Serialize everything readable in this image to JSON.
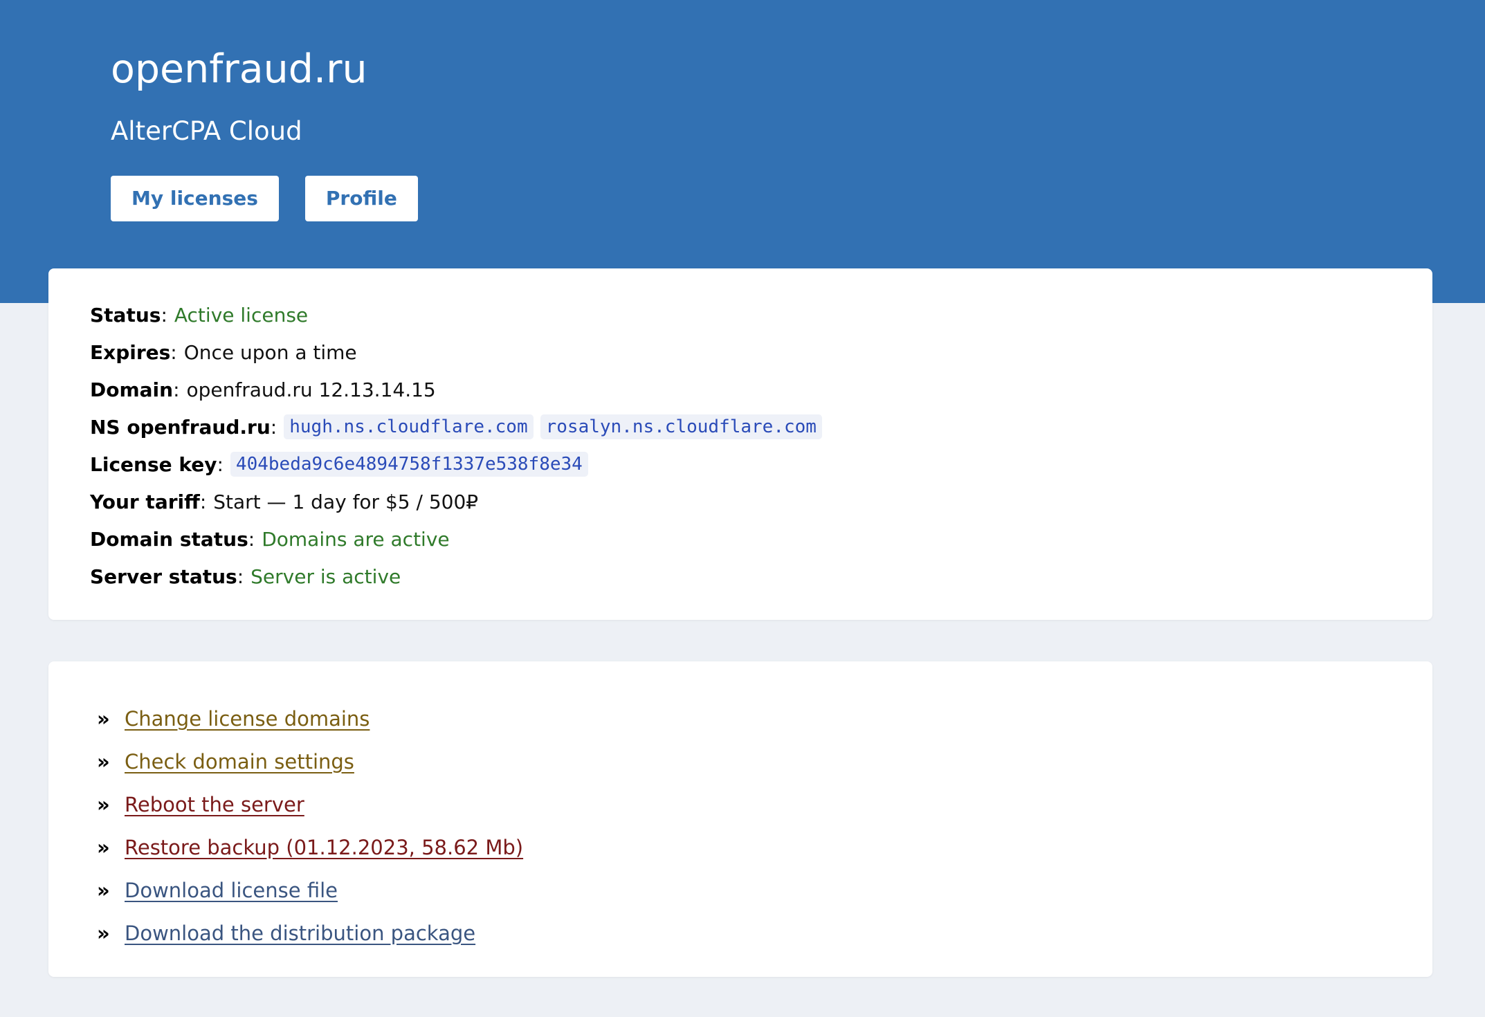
{
  "header": {
    "title": "openfraud.ru",
    "subtitle": "AlterCPA Cloud",
    "nav": {
      "my_licenses": "My licenses",
      "profile": "Profile"
    }
  },
  "license": {
    "status": {
      "label": "Status",
      "value": "Active license"
    },
    "expires": {
      "label": "Expires",
      "value": "Once upon a time"
    },
    "domain": {
      "label": "Domain",
      "value": "openfraud.ru 12.13.14.15"
    },
    "ns": {
      "label": "NS openfraud.ru",
      "servers": [
        "hugh.ns.cloudflare.com",
        "rosalyn.ns.cloudflare.com"
      ]
    },
    "license_key": {
      "label": "License key",
      "value": "404beda9c6e4894758f1337e538f8e34"
    },
    "tariff": {
      "label": "Your tariff",
      "value": "Start — 1 day for $5 / 500₽"
    },
    "domain_status": {
      "label": "Domain status",
      "value": "Domains are active"
    },
    "server_status": {
      "label": "Server status",
      "value": "Server is active"
    }
  },
  "actions": {
    "bullet": "»",
    "items": [
      {
        "label": "Change license domains",
        "color": "#7a5e12"
      },
      {
        "label": "Check domain settings",
        "color": "#7a5e12"
      },
      {
        "label": "Reboot the server",
        "color": "#7a1a1a"
      },
      {
        "label": "Restore backup (01.12.2023, 58.62 Mb)",
        "color": "#7a1a1a"
      },
      {
        "label": "Download license file",
        "color": "#3a5580"
      },
      {
        "label": "Download the distribution package",
        "color": "#3a5580"
      }
    ]
  },
  "colors": {
    "header_bg": "#3271b3",
    "page_bg": "#edf0f5",
    "status_green": "#2f7a2a",
    "code_text": "#2a4bb8"
  }
}
